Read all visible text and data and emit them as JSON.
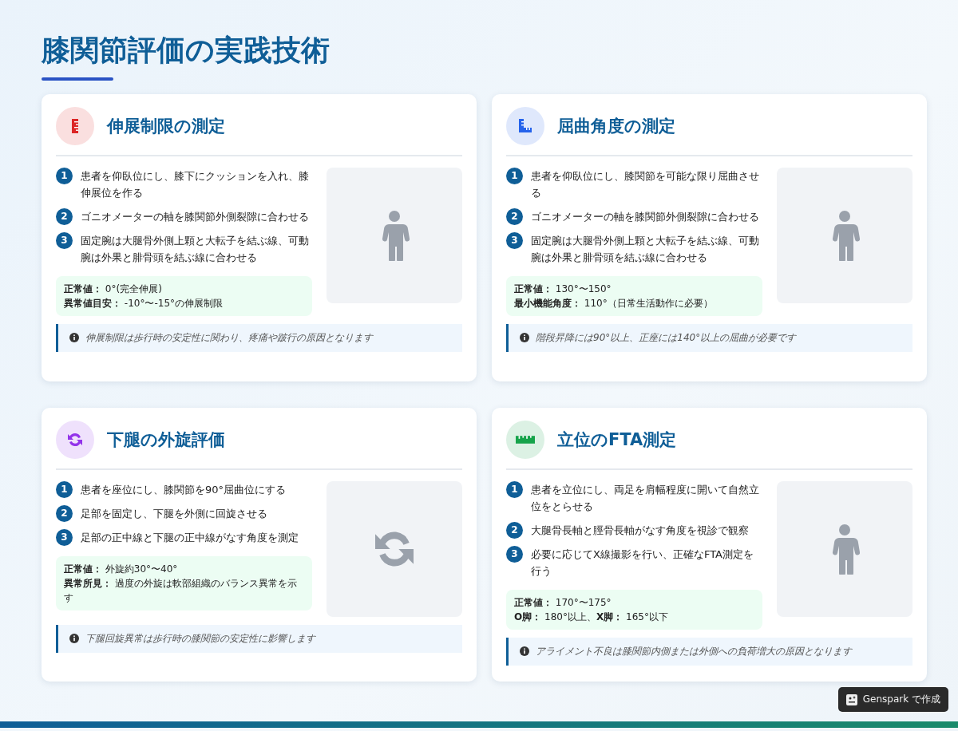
{
  "title": "膝関節評価の実践技術",
  "cards": [
    {
      "title": "伸展制限の測定",
      "icon": {
        "kind": "ruler-vertical"
      },
      "color": "#dc2626",
      "steps": [
        {
          "number": "1",
          "text": "患者を仰臥位にし、膝下にクッションを入れ、膝伸展位を作る"
        },
        {
          "number": "2",
          "text": "ゴニオメーターの軸を膝関節外側裂隙に合わせる"
        },
        {
          "number": "3",
          "text": "固定腕は大腿骨外側上顆と大転子を結ぶ線、可動腕は外果と腓骨頭を結ぶ線に合わせる"
        }
      ],
      "values": [
        "**正常値：** 0°(完全伸展)",
        "**異常値目安：** -10°〜-15°の伸展制限"
      ],
      "note": "伸展制限は歩行時の安定性に関わり、疼痛や跛行の原因となります",
      "illustration": {
        "kind": "person"
      }
    },
    {
      "title": "屈曲角度の測定",
      "icon": {
        "kind": "ruler-combined"
      },
      "color": "#2563eb",
      "steps": [
        {
          "number": "1",
          "text": "患者を仰臥位にし、膝関節を可能な限り屈曲させる"
        },
        {
          "number": "2",
          "text": "ゴニオメーターの軸を膝関節外側裂隙に合わせる"
        },
        {
          "number": "3",
          "text": "固定腕は大腿骨外側上顆と大転子を結ぶ線、可動腕は外果と腓骨頭を結ぶ線に合わせる"
        }
      ],
      "values": [
        "**正常値：** 130°〜150°",
        "**最小機能角度：** 110°（日常生活動作に必要）"
      ],
      "note": "階段昇降には90°以上、正座には140°以上の屈曲が必要です",
      "illustration": {
        "kind": "person"
      }
    },
    {
      "title": "下腿の外旋評価",
      "icon": {
        "kind": "rotate"
      },
      "color": "#9333ea",
      "steps": [
        {
          "number": "1",
          "text": "患者を座位にし、膝関節を90°屈曲位にする"
        },
        {
          "number": "2",
          "text": "足部を固定し、下腿を外側に回旋させる"
        },
        {
          "number": "3",
          "text": "足部の正中線と下腿の正中線がなす角度を測定"
        }
      ],
      "values": [
        "**正常値：** 外旋約30°〜40°",
        "**異常所見：** 過度の外旋は軟部組織のバランス異常を示す"
      ],
      "note": "下腿回旋異常は歩行時の膝関節の安定性に影響します",
      "illustration": {
        "kind": "rotate"
      }
    },
    {
      "title": "立位のFTA測定",
      "icon": {
        "kind": "ruler-horizontal"
      },
      "color": "#16a34a",
      "steps": [
        {
          "number": "1",
          "text": "患者を立位にし、両足を肩幅程度に開いて自然立位をとらせる"
        },
        {
          "number": "2",
          "text": "大腿骨長軸と脛骨長軸がなす角度を視診で観察"
        },
        {
          "number": "3",
          "text": "必要に応じてX線撮影を行い、正確なFTA測定を行う"
        }
      ],
      "values": [
        "**正常値：** 170°〜175°",
        "**O脚：** 180°以上、**X脚：** 165°以下"
      ],
      "note": "アライメント不良は膝関節内側または外側への負荷増大の原因となります",
      "illustration": {
        "kind": "person"
      }
    }
  ],
  "badge": "Genspark で作成"
}
